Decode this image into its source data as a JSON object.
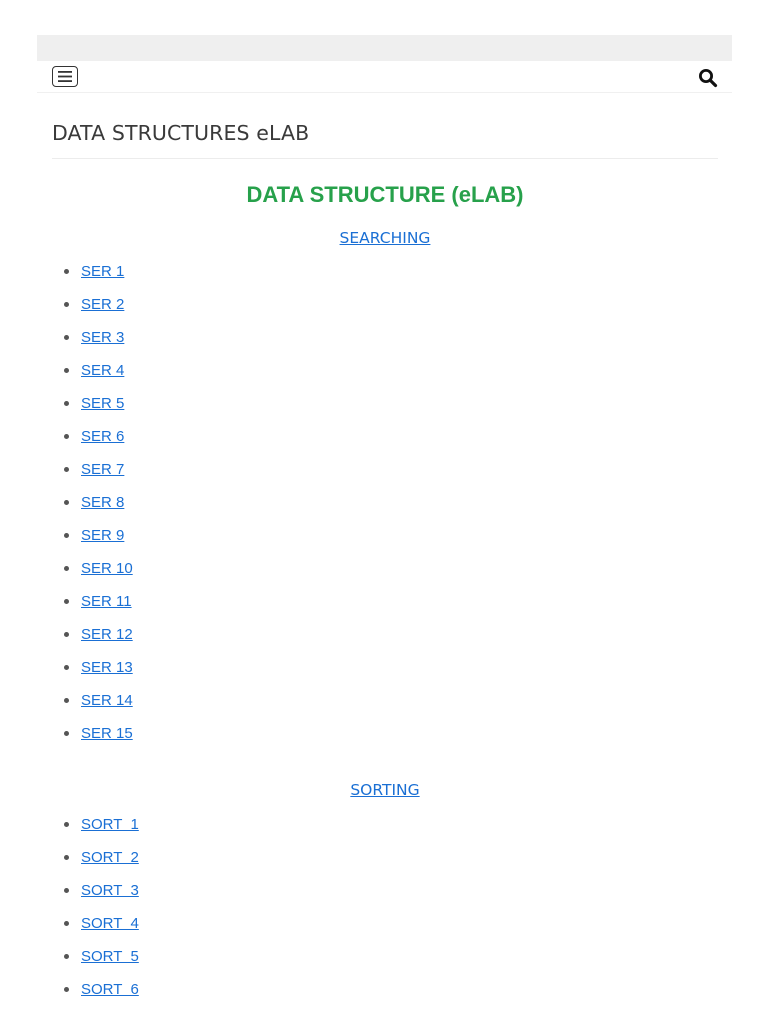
{
  "header": {
    "menu_icon": "hamburger-menu-icon",
    "search_icon": "search-icon"
  },
  "site_title": "DATA STRUCTURES eLAB",
  "main": {
    "heading": "DATA STRUCTURE (eLAB)",
    "heading_color": "#27a14b",
    "link_color": "#1a6fd4",
    "sections": [
      {
        "title": "SEARCHING",
        "items": [
          "SER 1",
          "SER 2",
          "SER 3",
          "SER 4",
          "SER 5",
          "SER 6",
          "SER 7",
          "SER 8",
          "SER 9",
          "SER 10",
          "SER 11",
          "SER 12",
          "SER 13",
          "SER 14",
          "SER 15"
        ]
      },
      {
        "title": "SORTING",
        "items": [
          "SORT  1",
          "SORT  2",
          "SORT  3",
          "SORT  4",
          "SORT  5",
          "SORT  6"
        ]
      }
    ]
  }
}
